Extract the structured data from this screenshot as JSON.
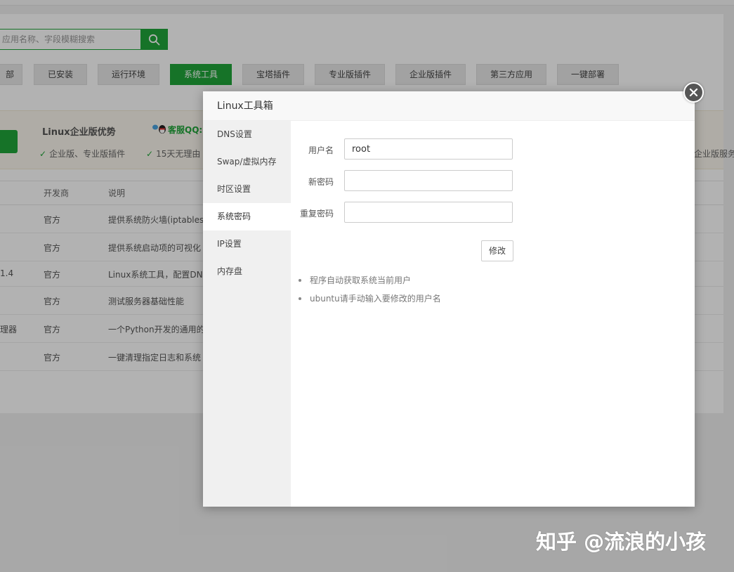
{
  "search": {
    "placeholder": "应用名称、字段模糊搜索"
  },
  "tabs": [
    {
      "label": "部",
      "active": false
    },
    {
      "label": "已安装",
      "active": false
    },
    {
      "label": "运行环境",
      "active": false
    },
    {
      "label": "系统工具",
      "active": true
    },
    {
      "label": "宝塔插件",
      "active": false
    },
    {
      "label": "专业版插件",
      "active": false
    },
    {
      "label": "企业版插件",
      "active": false
    },
    {
      "label": "第三方应用",
      "active": false
    },
    {
      "label": "一键部署",
      "active": false
    }
  ],
  "promo": {
    "title": "Linux企业版优势",
    "qq": "客服QQ:",
    "feature_1": "企业版、专业版插件",
    "feature_2": "15天无理由",
    "right_text": "企业版服务"
  },
  "table": {
    "headers": {
      "developer": "开发商",
      "description": "说明"
    },
    "rows": [
      {
        "name": "",
        "developer": "官方",
        "description": "提供系统防火墙(iptables,"
      },
      {
        "name": "",
        "developer": "官方",
        "description": "提供系统启动项的可视化"
      },
      {
        "name": "1.4",
        "developer": "官方",
        "description": "Linux系统工具，配置DNS"
      },
      {
        "name": "",
        "developer": "官方",
        "description": "测试服务器基础性能"
      },
      {
        "name": "理器",
        "developer": "官方",
        "description": "一个Python开发的通用的"
      },
      {
        "name": "",
        "developer": "官方",
        "description": "一键清理指定日志和系统"
      }
    ]
  },
  "modal": {
    "title": "Linux工具箱",
    "sidebar": [
      {
        "label": "DNS设置",
        "active": false
      },
      {
        "label": "Swap/虚拟内存",
        "active": false
      },
      {
        "label": "时区设置",
        "active": false
      },
      {
        "label": "系统密码",
        "active": true
      },
      {
        "label": "IP设置",
        "active": false
      },
      {
        "label": "内存盘",
        "active": false
      }
    ],
    "form": {
      "username_label": "用户名",
      "username_value": "root",
      "new_password_label": "新密码",
      "new_password_value": "",
      "repeat_password_label": "重复密码",
      "repeat_password_value": "",
      "submit_label": "修改"
    },
    "tips": [
      "程序自动获取系统当前用户",
      "ubuntu请手动输入要修改的用户名"
    ]
  },
  "watermark": "知乎 @流浪的小孩",
  "colors": {
    "accent": "#20a53a",
    "overlay": "rgba(0,0,0,0.3)"
  },
  "icons": {
    "search": "search-icon",
    "close": "close-icon",
    "check": "check-icon",
    "qq": "qq-icon"
  }
}
